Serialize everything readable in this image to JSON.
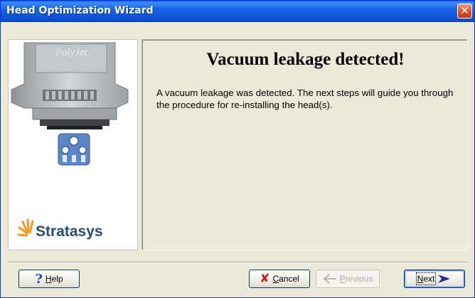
{
  "window": {
    "title": "Head Optimization Wizard",
    "close_glyph": "✕"
  },
  "sidebar": {
    "brand": "Stratasys",
    "head_logo_text": "PolyJet",
    "icons": [
      "printer-head-illustration",
      "vacuum-gauges-icon",
      "stratasys-logo-icon"
    ]
  },
  "content": {
    "headline": "Vacuum leakage detected!",
    "message": "A vacuum leakage was detected. The next steps will guide you through the procedure for re-installing the head(s)."
  },
  "buttons": {
    "help": "Help",
    "cancel": "Cancel",
    "previous": "Previous",
    "next": "Next"
  },
  "colors": {
    "title_bar": "#0a52d6",
    "dialog_bg": "#ece9d8",
    "cancel_x": "#d11f1f",
    "help_q": "#2a3fd6",
    "next_arrow": "#2a2a9a",
    "brand_text": "#2b4c6f"
  }
}
